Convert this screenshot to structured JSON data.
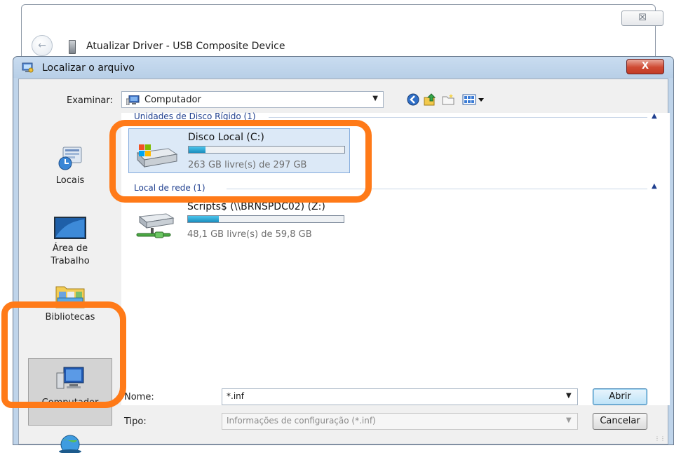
{
  "parent_window": {
    "title": "Atualizar Driver -  USB Composite Device",
    "close_label": "☒"
  },
  "dialog": {
    "title": "Localizar o arquivo",
    "close_label": "X",
    "lookin": {
      "label": "Examinar:",
      "value": "Computador"
    },
    "toolbar": {
      "back_icon": "back-arrow-icon",
      "up_icon": "up-folder-icon",
      "new_folder_icon": "new-folder-icon",
      "views_icon": "views-menu-icon"
    },
    "places": [
      {
        "label": "Locais",
        "icon": "recent-places-icon"
      },
      {
        "label": "Área de\nTrabalho",
        "icon": "desktop-icon"
      },
      {
        "label": "Bibliotecas",
        "icon": "libraries-icon"
      },
      {
        "label": "Computador",
        "icon": "computer-icon",
        "selected": true
      },
      {
        "label": "",
        "icon": "network-icon"
      }
    ],
    "groups": [
      {
        "header": "Unidades de Disco Rígido (1)",
        "items": [
          {
            "name": "Disco Local (C:)",
            "free_text": "263 GB livre(s) de 297 GB",
            "used_fraction": 0.11,
            "selected": true,
            "icon": "hard-drive-icon"
          }
        ]
      },
      {
        "header": "Local de rede (1)",
        "items": [
          {
            "name": "Scripts$ (\\\\BRNSPDC02) (Z:)",
            "free_text": "48,1 GB livre(s) de 59,8 GB",
            "used_fraction": 0.2,
            "selected": false,
            "icon": "network-drive-icon"
          }
        ]
      }
    ],
    "filename": {
      "label": "Nome:",
      "value": "*.inf"
    },
    "filetype": {
      "label": "Tipo:",
      "value": "Informações de configuração (*.inf)"
    },
    "buttons": {
      "open": "Abrir",
      "cancel": "Cancelar"
    },
    "colors": {
      "highlight_annotation": "#ff7a18",
      "selection": "#dce9f7",
      "progress": "#1b8dbd"
    }
  }
}
